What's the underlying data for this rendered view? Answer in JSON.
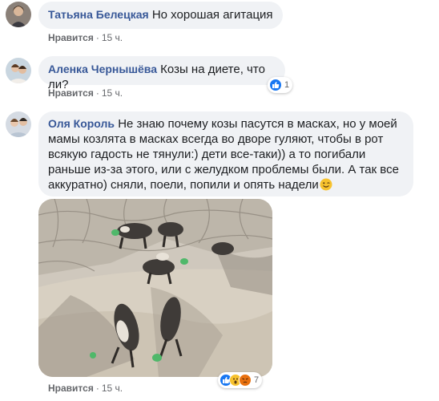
{
  "comments": [
    {
      "author": "Татьяна Белецкая",
      "text": "Но хорошая агитация",
      "like_label": "Нравится",
      "separator": "·",
      "time": "15 ч."
    },
    {
      "author": "Аленка Чернышёва",
      "text": "Козы на диете, что ли?",
      "like_label": "Нравится",
      "separator": "·",
      "time": "15 ч.",
      "reactions": {
        "icons": [
          "like-icon"
        ],
        "count": "1"
      }
    },
    {
      "author": "Оля Король",
      "text": "Не знаю почему козы пасутся в масках, но у моей мамы козлята в масках всегда во дворе гуляют, чтобы в рот всякую гадость не тянули:) дети все-таки)) а то погибали раньше из-за этого, или с желудком проблемы были. А так все аккуратно) сняли, поели, попили и опять надели",
      "emoji": "winking-face-icon",
      "like_label": "Нравится",
      "separator": "·",
      "time": "15 ч.",
      "reactions": {
        "icons": [
          "like-icon",
          "wow-icon",
          "angry-icon"
        ],
        "count": "7"
      }
    }
  ],
  "colors": {
    "author": "#385898",
    "bubble": "#f0f2f5",
    "meta": "#65676b",
    "like_blue": "#1877f2"
  }
}
